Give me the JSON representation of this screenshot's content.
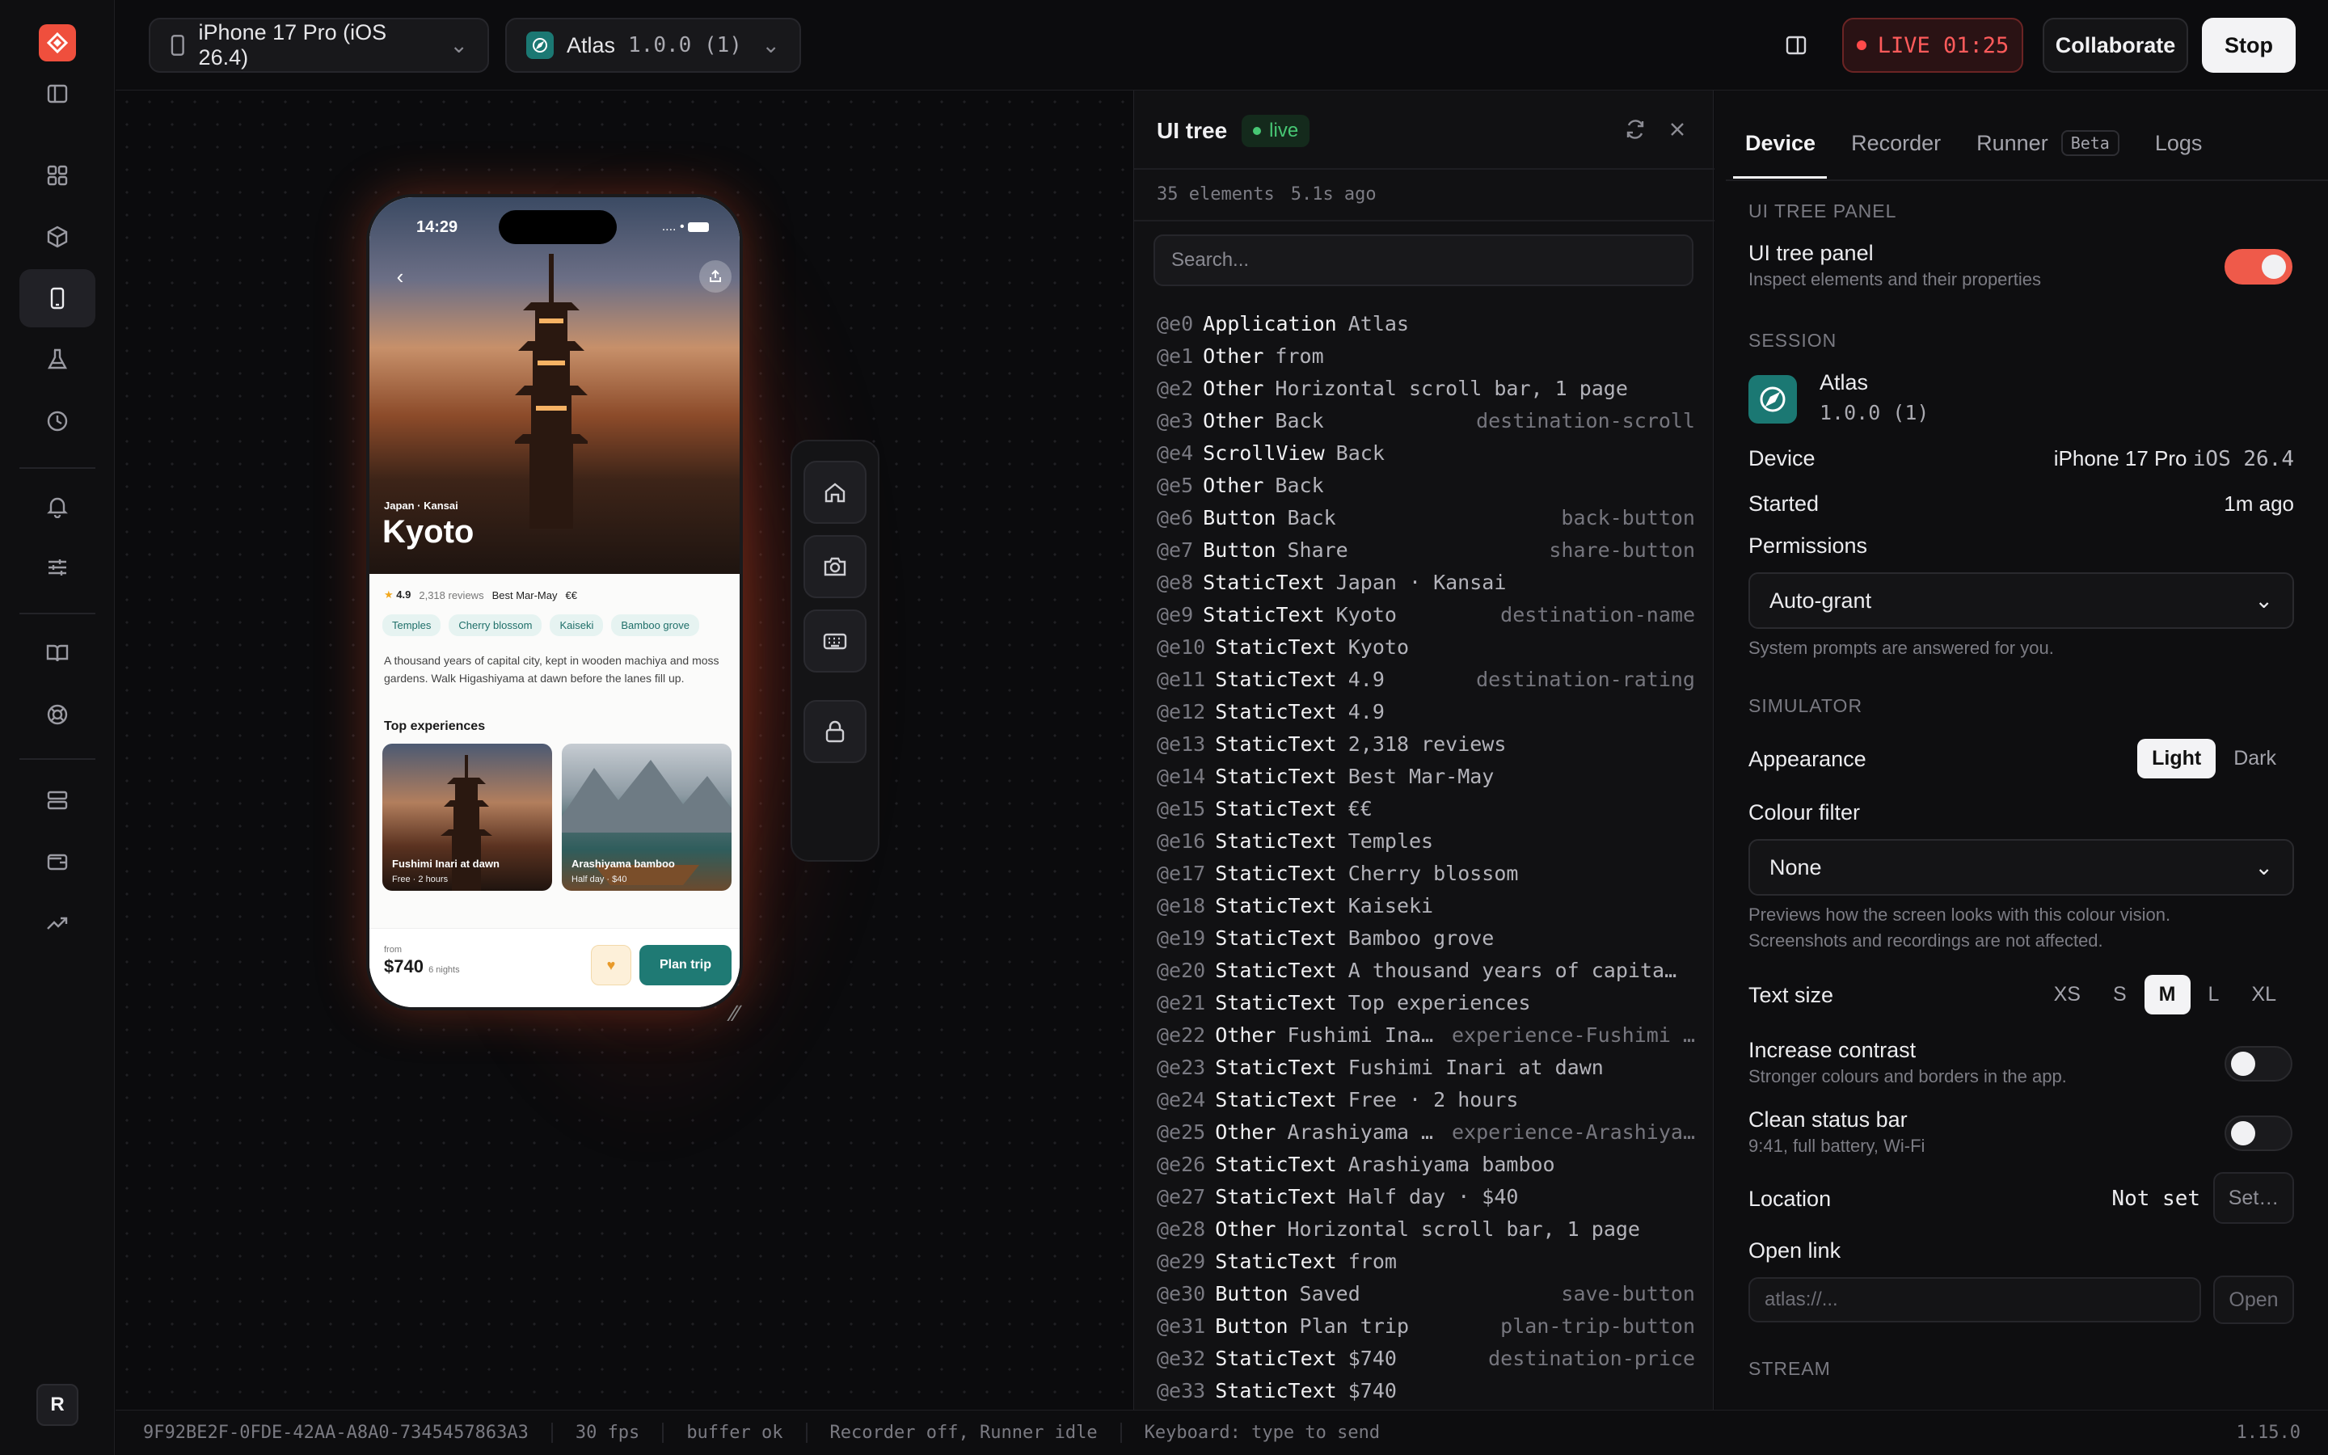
{
  "topbar": {
    "device_label": "iPhone 17 Pro (iOS 26.4)",
    "app_name": "Atlas",
    "app_version": "1.0.0 (1)",
    "live_label": "LIVE 01:25",
    "collaborate_label": "Collaborate",
    "stop_label": "Stop"
  },
  "rail": {
    "avatar_initial": "R"
  },
  "phone": {
    "time": "14:29",
    "status_icons": "....",
    "kicker": "Japan · Kansai",
    "city": "Kyoto",
    "rating_value": "4.9",
    "reviews": "2,318 reviews",
    "best": "Best Mar-May",
    "price_level": "€€",
    "tags": [
      "Temples",
      "Cherry blossom",
      "Kaiseki",
      "Bamboo grove"
    ],
    "blurb": "A thousand years of capital city, kept in wooden machiya and moss gardens. Walk Higashiyama at dawn before the lanes fill up.",
    "top_title": "Top experiences",
    "experiences": [
      {
        "title": "Fushimi Inari at dawn",
        "meta": "Free · 2 hours"
      },
      {
        "title": "Arashiyama bamboo",
        "meta": "Half day · $40"
      }
    ],
    "from_label": "from",
    "price": "$740",
    "nights": "6 nights",
    "plan_label": "Plan trip"
  },
  "tree": {
    "title": "UI tree",
    "live": "live",
    "count": "35 elements",
    "age": "5.1s ago",
    "search_placeholder": "Search...",
    "rows": [
      {
        "id": "@e0",
        "role": "Application",
        "label": "Atlas",
        "tid": ""
      },
      {
        "id": "@e1",
        "role": "Other",
        "label": "from",
        "tid": ""
      },
      {
        "id": "@e2",
        "role": "Other",
        "label": "Horizontal scroll bar, 1 page",
        "tid": ""
      },
      {
        "id": "@e3",
        "role": "Other",
        "label": "Back",
        "tid": "destination-scroll"
      },
      {
        "id": "@e4",
        "role": "ScrollView",
        "label": "Back",
        "tid": ""
      },
      {
        "id": "@e5",
        "role": "Other",
        "label": "Back",
        "tid": ""
      },
      {
        "id": "@e6",
        "role": "Button",
        "label": "Back",
        "tid": "back-button"
      },
      {
        "id": "@e7",
        "role": "Button",
        "label": "Share",
        "tid": "share-button"
      },
      {
        "id": "@e8",
        "role": "StaticText",
        "label": "Japan · Kansai",
        "tid": ""
      },
      {
        "id": "@e9",
        "role": "StaticText",
        "label": "Kyoto",
        "tid": "destination-name"
      },
      {
        "id": "@e10",
        "role": "StaticText",
        "label": "Kyoto",
        "tid": ""
      },
      {
        "id": "@e11",
        "role": "StaticText",
        "label": "4.9",
        "tid": "destination-rating"
      },
      {
        "id": "@e12",
        "role": "StaticText",
        "label": "4.9",
        "tid": ""
      },
      {
        "id": "@e13",
        "role": "StaticText",
        "label": "2,318 reviews",
        "tid": ""
      },
      {
        "id": "@e14",
        "role": "StaticText",
        "label": "Best Mar-May",
        "tid": ""
      },
      {
        "id": "@e15",
        "role": "StaticText",
        "label": "€€",
        "tid": ""
      },
      {
        "id": "@e16",
        "role": "StaticText",
        "label": "Temples",
        "tid": ""
      },
      {
        "id": "@e17",
        "role": "StaticText",
        "label": "Cherry blossom",
        "tid": ""
      },
      {
        "id": "@e18",
        "role": "StaticText",
        "label": "Kaiseki",
        "tid": ""
      },
      {
        "id": "@e19",
        "role": "StaticText",
        "label": "Bamboo grove",
        "tid": ""
      },
      {
        "id": "@e20",
        "role": "StaticText",
        "label": "A thousand years of capital c…",
        "tid": ""
      },
      {
        "id": "@e21",
        "role": "StaticText",
        "label": "Top experiences",
        "tid": ""
      },
      {
        "id": "@e22",
        "role": "Other",
        "label": "Fushimi Inar…",
        "tid": "experience-Fushimi …"
      },
      {
        "id": "@e23",
        "role": "StaticText",
        "label": "Fushimi Inari at dawn",
        "tid": ""
      },
      {
        "id": "@e24",
        "role": "StaticText",
        "label": "Free · 2 hours",
        "tid": ""
      },
      {
        "id": "@e25",
        "role": "Other",
        "label": "Arashiyama …",
        "tid": "experience-Arashiya…"
      },
      {
        "id": "@e26",
        "role": "StaticText",
        "label": "Arashiyama bamboo",
        "tid": ""
      },
      {
        "id": "@e27",
        "role": "StaticText",
        "label": "Half day · $40",
        "tid": ""
      },
      {
        "id": "@e28",
        "role": "Other",
        "label": "Horizontal scroll bar, 1 page",
        "tid": ""
      },
      {
        "id": "@e29",
        "role": "StaticText",
        "label": "from",
        "tid": ""
      },
      {
        "id": "@e30",
        "role": "Button",
        "label": "Saved",
        "tid": "save-button"
      },
      {
        "id": "@e31",
        "role": "Button",
        "label": "Plan trip",
        "tid": "plan-trip-button"
      },
      {
        "id": "@e32",
        "role": "StaticText",
        "label": "$740",
        "tid": "destination-price"
      },
      {
        "id": "@e33",
        "role": "StaticText",
        "label": "$740",
        "tid": ""
      }
    ]
  },
  "panel": {
    "tabs": [
      "Device",
      "Recorder",
      "Runner",
      "Logs"
    ],
    "beta": "Beta",
    "sec_tree": "UI TREE PANEL",
    "tree_panel_label": "UI tree panel",
    "tree_panel_sub": "Inspect elements and their properties",
    "sec_session": "SESSION",
    "app_name": "Atlas",
    "app_version": "1.0.0 (1)",
    "device_label": "Device",
    "device_name": "iPhone 17 Pro",
    "device_os": "iOS 26.4",
    "started_label": "Started",
    "started_value": "1m ago",
    "permissions_label": "Permissions",
    "permissions_value": "Auto-grant",
    "permissions_sub": "System prompts are answered for you.",
    "sec_sim": "SIMULATOR",
    "appearance_label": "Appearance",
    "appearance_options": [
      "Light",
      "Dark"
    ],
    "colour_label": "Colour filter",
    "colour_value": "None",
    "colour_sub1": "Previews how the screen looks with this colour vision.",
    "colour_sub2": "Screenshots and recordings are not affected.",
    "textsize_label": "Text size",
    "textsize_options": [
      "XS",
      "S",
      "M",
      "L",
      "XL"
    ],
    "contrast_label": "Increase contrast",
    "contrast_sub": "Stronger colours and borders in the app.",
    "clean_label": "Clean status bar",
    "clean_sub": "9:41, full battery, Wi-Fi",
    "location_label": "Location",
    "location_value": "Not set",
    "location_btn": "Set…",
    "openlink_label": "Open link",
    "openlink_placeholder": "atlas://...",
    "open_btn": "Open",
    "sec_stream": "STREAM"
  },
  "status": {
    "session_id": "9F92BE2F-0FDE-42AA-A8A0-7345457863A3",
    "fps": "30 fps",
    "buffer": "buffer ok",
    "recorder": "Recorder off, Runner idle",
    "keyboard": "Keyboard: type to send",
    "version": "1.15.0"
  },
  "colors": {
    "accent": "#ef4f3d",
    "teal": "#1f7a74",
    "live_green": "#47c774"
  }
}
